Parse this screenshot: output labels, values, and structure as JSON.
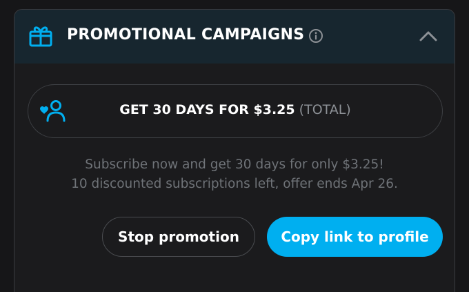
{
  "panel": {
    "title": "PROMOTIONAL CAMPAIGNS",
    "icons": {
      "header": "gift-icon",
      "info": "info-icon",
      "collapse": "chevron-up-icon",
      "offer": "user-heart-icon"
    },
    "colors": {
      "accent": "#00aff0",
      "header_bg": "#17262f",
      "panel_bg": "#1b1b1d",
      "muted_text": "#6f7378"
    }
  },
  "offer": {
    "main_text": "GET 30 DAYS FOR $3.25",
    "suffix_text": "(TOTAL)"
  },
  "description": {
    "line1": "Subscribe now and get 30 days for only $3.25!",
    "line2": "10 discounted subscriptions left, offer ends Apr 26."
  },
  "actions": {
    "stop_label": "Stop promotion",
    "copy_label": "Copy link to profile"
  }
}
